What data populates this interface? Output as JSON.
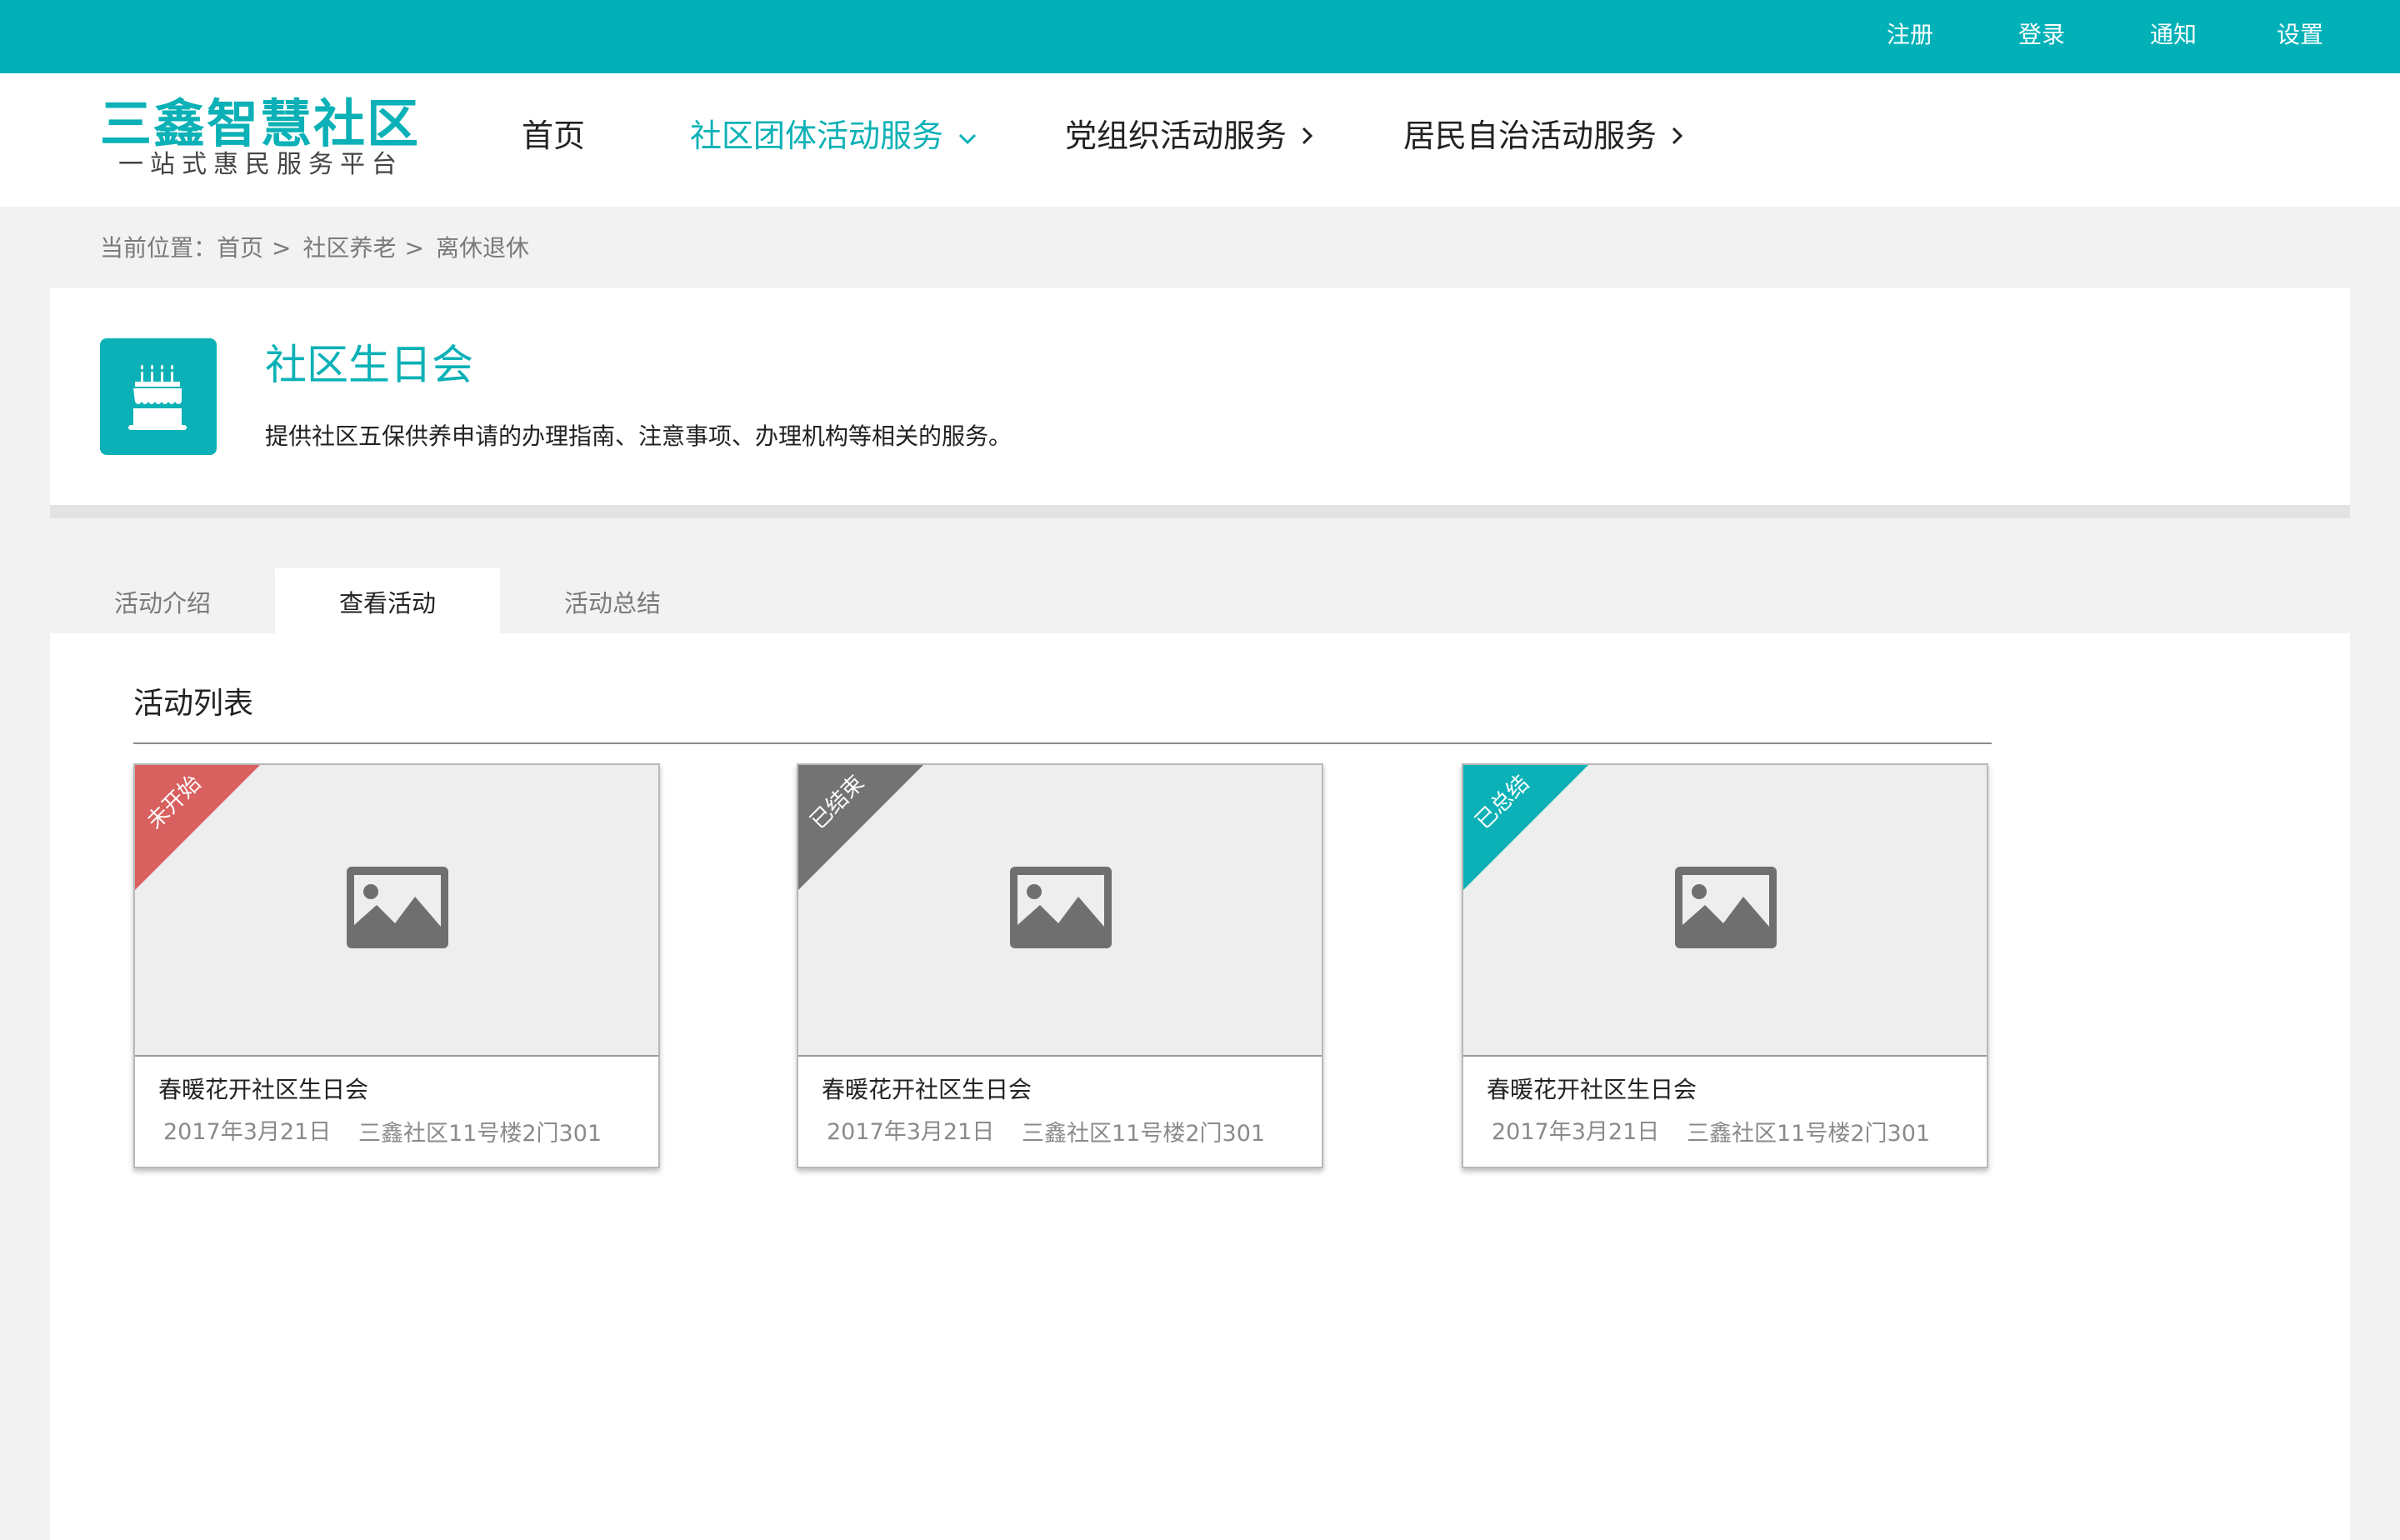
{
  "colors": {
    "topbar": "#02b1b8",
    "accent": "#0bb1b6",
    "status_not_started": "#d8605f",
    "status_ended": "#737373",
    "status_summarized": "#0bb1b6"
  },
  "topbar": {
    "links": [
      "注册",
      "登录",
      "通知",
      "设置"
    ]
  },
  "logo": {
    "title": "三鑫智慧社区",
    "subtitle": "一站式惠民服务平台"
  },
  "nav": {
    "items": [
      {
        "label": "首页",
        "icon": ""
      },
      {
        "label": "社区团体活动服务",
        "icon": "chevron-down-icon"
      },
      {
        "label": "党组织活动服务",
        "icon": "chevron-right-icon"
      },
      {
        "label": "居民自治活动服务",
        "icon": "chevron-right-icon"
      }
    ],
    "active": "社区团体活动服务"
  },
  "breadcrumb": {
    "prefix": "当前位置：",
    "items": [
      "首页",
      "社区养老",
      "离休退休"
    ],
    "separator": ">"
  },
  "service": {
    "icon": "birthday-cake-icon",
    "title": "社区生日会",
    "description": "提供社区五保供养申请的办理指南、注意事项、办理机构等相关的服务。"
  },
  "tabs": {
    "items": [
      "活动介绍",
      "查看活动",
      "活动总结"
    ],
    "active": "查看活动"
  },
  "activity_list": {
    "title": "活动列表",
    "cards": [
      {
        "status": "未开始",
        "status_color": "#d8605f",
        "image_icon": "image-placeholder-icon",
        "title": "春暖花开社区生日会",
        "date": "2017年3月21日",
        "address": "三鑫社区11号楼2门301"
      },
      {
        "status": "已结束",
        "status_color": "#737373",
        "image_icon": "image-placeholder-icon",
        "title": "春暖花开社区生日会",
        "date": "2017年3月21日",
        "address": "三鑫社区11号楼2门301"
      },
      {
        "status": "已总结",
        "status_color": "#0bb1b6",
        "image_icon": "image-placeholder-icon",
        "title": "春暖花开社区生日会",
        "date": "2017年3月21日",
        "address": "三鑫社区11号楼2门301"
      }
    ]
  }
}
